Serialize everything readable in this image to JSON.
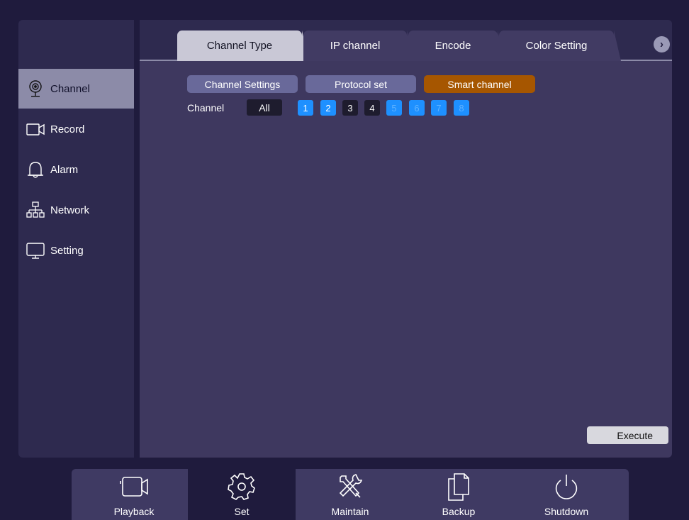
{
  "sidebar": {
    "items": [
      {
        "label": "Channel",
        "icon": "webcam-icon",
        "active": true
      },
      {
        "label": "Record",
        "icon": "video-camera-icon",
        "active": false
      },
      {
        "label": "Alarm",
        "icon": "bell-icon",
        "active": false
      },
      {
        "label": "Network",
        "icon": "network-icon",
        "active": false
      },
      {
        "label": "Setting",
        "icon": "monitor-icon",
        "active": false
      }
    ]
  },
  "tabs": [
    {
      "label": "Channel Type",
      "active": true
    },
    {
      "label": "IP channel",
      "active": false
    },
    {
      "label": "Encode",
      "active": false
    },
    {
      "label": "Color Setting",
      "active": false
    }
  ],
  "next_tab_icon": "chevron-right-icon",
  "subtabs": [
    {
      "label": "Channel Settings"
    },
    {
      "label": "Protocol set"
    },
    {
      "label": "Smart channel",
      "active": true
    }
  ],
  "channel": {
    "label": "Channel",
    "all_label": "All",
    "numbers": [
      "1",
      "2",
      "3",
      "4",
      "5",
      "6",
      "7",
      "8"
    ]
  },
  "execute_label": "Execute",
  "bottom": {
    "items": [
      {
        "label": "Playback",
        "icon": "camera-icon"
      },
      {
        "label": "Set",
        "icon": "gear-icon",
        "active": true
      },
      {
        "label": "Maintain",
        "icon": "tools-icon"
      },
      {
        "label": "Backup",
        "icon": "documents-icon"
      },
      {
        "label": "Shutdown",
        "icon": "power-icon"
      }
    ]
  },
  "colors": {
    "background": "#1f1b3d",
    "panel": "#3e385f",
    "accent_blue": "#1e90ff",
    "accent_orange": "#a65600"
  }
}
